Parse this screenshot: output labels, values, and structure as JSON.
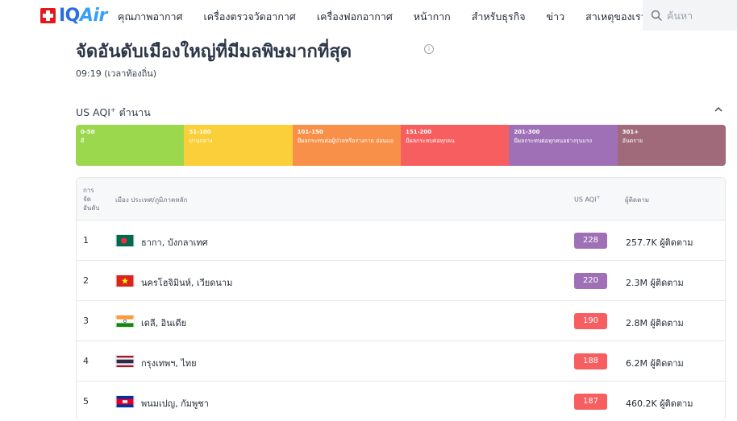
{
  "header": {
    "logo": {
      "text_iq": "IQ",
      "text_air": "Air"
    },
    "nav": [
      "คุณภาพอากาศ",
      "เครื่องตรวจวัดอากาศ",
      "เครื่องฟอกอากาศ",
      "หน้ากาก",
      "สำหรับธุรกิจ",
      "ข่าว",
      "สาเหตุของเรา"
    ],
    "search_placeholder": "ค้นหา"
  },
  "page": {
    "title": "จัดอันดับเมืองใหญ่ที่มีมลพิษมากที่สุด",
    "local_time": "09:19 (เวลาท้องถิ่น)"
  },
  "legend": {
    "label": "US AQI",
    "label_sup": "+",
    "label_suffix": " ตำนาน",
    "segments": [
      {
        "range": "0-50",
        "text": "ดี",
        "color": "#9cd84e"
      },
      {
        "range": "51-100",
        "text": "ปานกลาง",
        "color": "#facf39"
      },
      {
        "range": "101-150",
        "text": "มีผลกระทบต่อผู้ป่วยหรือร่างกาย อ่อนแอ",
        "color": "#f99049"
      },
      {
        "range": "151-200",
        "text": "มีผลกระทบต่อทุกคน",
        "color": "#f65e5f"
      },
      {
        "range": "201-300",
        "text": "มีผลกระทบต่อทุกคนอย่างรุนแรง",
        "color": "#a070b6"
      },
      {
        "range": "301+",
        "text": "อันตราย",
        "color": "#a06a7b"
      }
    ]
  },
  "table": {
    "headers": {
      "rank_lines": [
        "การ",
        "จัด",
        "อันดับ"
      ],
      "city": "เมือง ประเทศ/ภูมิภาคหลัก",
      "aqi": "US AQI",
      "aqi_sup": "+",
      "followers": "ผู้ติดตาม"
    },
    "rows": [
      {
        "rank": "1",
        "city": "ธากา, บังกลาเทศ",
        "aqi": "228",
        "followers": "257.7K ผู้ติดตาม",
        "badge_color": "#a070b6",
        "flag": "bangladesh"
      },
      {
        "rank": "2",
        "city": "นครโฮจิมินห์, เวียดนาม",
        "aqi": "220",
        "followers": "2.3M ผู้ติดตาม",
        "badge_color": "#a070b6",
        "flag": "vietnam"
      },
      {
        "rank": "3",
        "city": "เดลี, อินเดีย",
        "aqi": "190",
        "followers": "2.8M ผู้ติดตาม",
        "badge_color": "#f65e5f",
        "flag": "india"
      },
      {
        "rank": "4",
        "city": "กรุงเทพฯ, ไทย",
        "aqi": "188",
        "followers": "6.2M ผู้ติดตาม",
        "badge_color": "#f65e5f",
        "flag": "thailand"
      },
      {
        "rank": "5",
        "city": "พนมเปญ, กัมพูชา",
        "aqi": "187",
        "followers": "460.2K ผู้ติดตาม",
        "badge_color": "#f65e5f",
        "flag": "cambodia"
      }
    ]
  }
}
